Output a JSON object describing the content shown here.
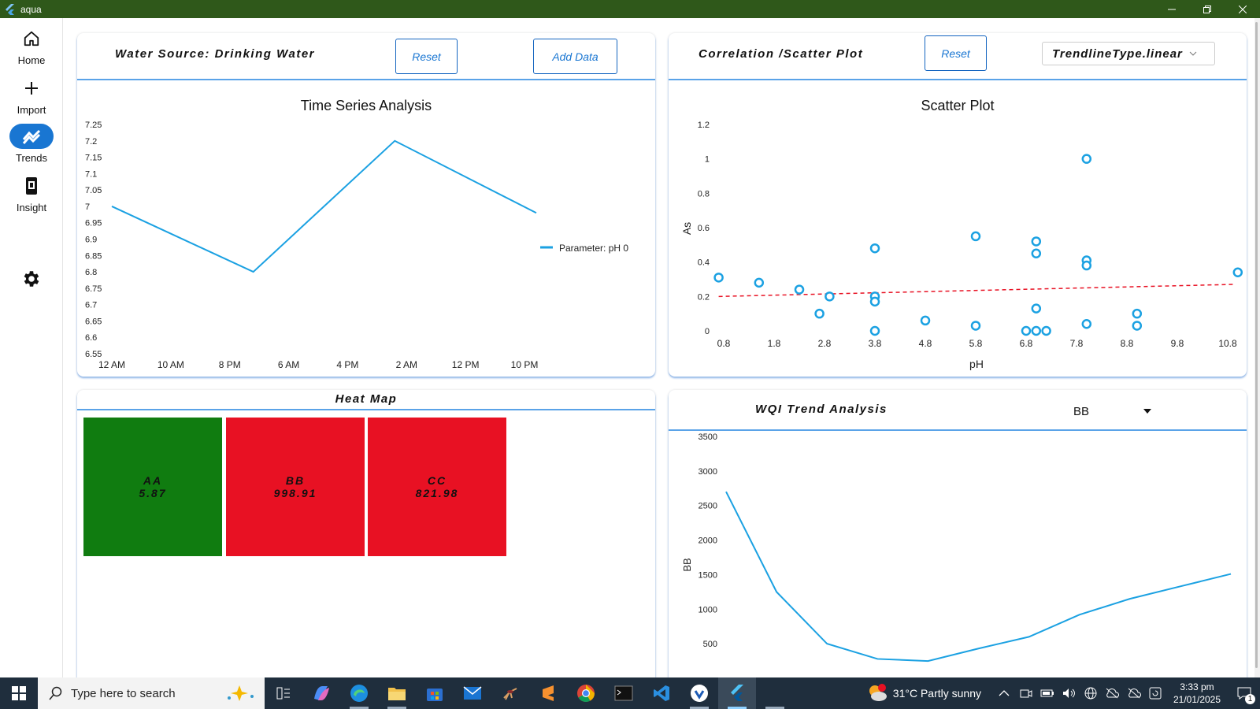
{
  "window": {
    "title": "aqua",
    "accent": "#2f581a"
  },
  "rail": {
    "items": [
      {
        "label": "Home",
        "icon": "home-icon"
      },
      {
        "label": "Import",
        "icon": "plus-icon"
      },
      {
        "label": "Trends",
        "icon": "trends-icon",
        "active": true
      },
      {
        "label": "Insight",
        "icon": "insight-icon"
      }
    ],
    "settings_icon": "gear-icon"
  },
  "ts_card": {
    "title": "Water Source: Drinking Water",
    "reset_label": "Reset",
    "add_label": "Add Data",
    "chart_title": "Time Series Analysis",
    "legend": "Parameter: pH 0"
  },
  "scatter_card": {
    "title": "Correlation /Scatter Plot",
    "reset_label": "Reset",
    "trend_select": "TrendlineType.linear",
    "chart_title": "Scatter Plot",
    "xlabel": "pH",
    "ylabel": "As"
  },
  "heat_card": {
    "title": "Heat Map",
    "cells": [
      {
        "name": "AA",
        "value": "5.87",
        "color": "#107c10"
      },
      {
        "name": "BB",
        "value": "998.91",
        "color": "#e81123"
      },
      {
        "name": "CC",
        "value": "821.98",
        "color": "#e81123"
      }
    ]
  },
  "wqi_card": {
    "title": "WQI Trend Analysis",
    "select": "BB",
    "ylabel": "BB"
  },
  "taskbar": {
    "search_placeholder": "Type here to search",
    "weather": "31°C  Partly sunny",
    "time": "3:33 pm",
    "date": "21/01/2025",
    "notif_count": "1"
  },
  "chart_data": [
    {
      "type": "line",
      "title": "Time Series Analysis",
      "x": [
        "12 AM",
        "10 AM",
        "8 PM",
        "6 AM",
        "4 PM",
        "2 AM",
        "12 PM",
        "10 PM"
      ],
      "series": [
        {
          "name": "Parameter: pH 0",
          "points": [
            [
              0,
              7.0
            ],
            [
              2.4,
              6.8
            ],
            [
              4.8,
              7.2
            ],
            [
              7.2,
              6.98
            ]
          ]
        }
      ],
      "ylim": [
        6.55,
        7.25
      ],
      "yticks": [
        "7.25",
        "7.2",
        "7.15",
        "7.1",
        "7.05",
        "7",
        "6.95",
        "6.9",
        "6.85",
        "6.8",
        "6.75",
        "6.7",
        "6.65",
        "6.6",
        "6.55"
      ],
      "color": "#1ba1e2"
    },
    {
      "type": "scatter",
      "title": "Scatter Plot",
      "xlabel": "pH",
      "ylabel": "As",
      "xticks": [
        "0.8",
        "1.8",
        "2.8",
        "3.8",
        "4.8",
        "5.8",
        "6.8",
        "7.8",
        "8.8",
        "9.8",
        "10.8"
      ],
      "yticks": [
        "1.2",
        "1",
        "0.8",
        "0.6",
        "0.4",
        "0.2",
        "0"
      ],
      "xlim": [
        0.8,
        10.8
      ],
      "ylim": [
        0,
        1.2
      ],
      "points": [
        [
          0.7,
          0.31
        ],
        [
          1.5,
          0.28
        ],
        [
          2.3,
          0.24
        ],
        [
          2.7,
          0.1
        ],
        [
          2.9,
          0.2
        ],
        [
          3.8,
          0.48
        ],
        [
          3.8,
          0.2
        ],
        [
          3.8,
          0.17
        ],
        [
          3.8,
          0.0
        ],
        [
          4.8,
          0.06
        ],
        [
          5.8,
          0.55
        ],
        [
          5.8,
          0.03
        ],
        [
          6.8,
          0.0
        ],
        [
          7.0,
          0.0
        ],
        [
          7.2,
          0.0
        ],
        [
          7.0,
          0.52
        ],
        [
          7.0,
          0.45
        ],
        [
          7.0,
          0.13
        ],
        [
          8.0,
          1.0
        ],
        [
          8.0,
          0.41
        ],
        [
          8.0,
          0.38
        ],
        [
          8.0,
          0.04
        ],
        [
          9.0,
          0.1
        ],
        [
          9.0,
          0.03
        ],
        [
          11.0,
          0.34
        ]
      ],
      "trendline": [
        [
          0.7,
          0.2
        ],
        [
          10.9,
          0.27
        ]
      ],
      "color": "#1ba1e2",
      "trend_color": "#e81123"
    },
    {
      "type": "line",
      "title": "WQI Trend Analysis",
      "ylabel": "BB",
      "yticks": [
        "3500",
        "3000",
        "2500",
        "2000",
        "1500",
        "1000",
        "500"
      ],
      "ylim": [
        0,
        3500
      ],
      "series": [
        {
          "name": "BB",
          "values": [
            2700,
            1250,
            500,
            280,
            250,
            430,
            600,
            920,
            1150,
            1330,
            1510
          ]
        }
      ],
      "color": "#1ba1e2"
    }
  ]
}
